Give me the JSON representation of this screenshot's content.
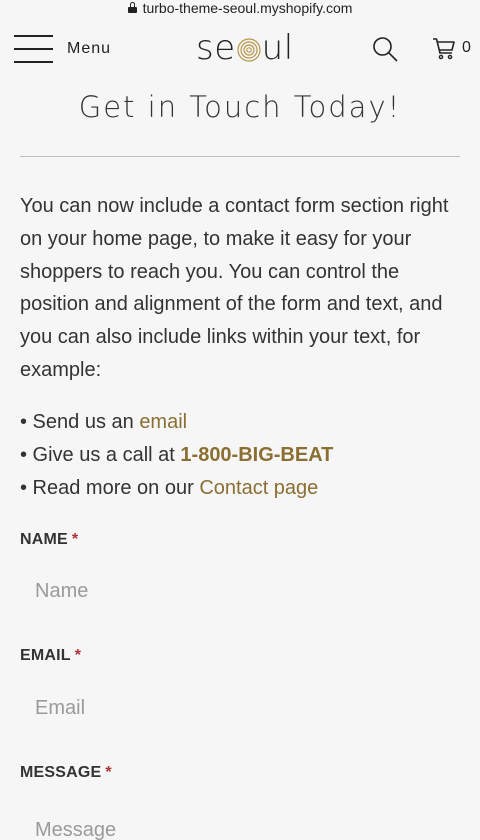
{
  "browser": {
    "url": "turbo-theme-seoul.myshopify.com"
  },
  "header": {
    "menu_label": "Menu",
    "logo_text_left": "se",
    "logo_text_right": "ul",
    "cart_count": "0"
  },
  "page": {
    "title": "Get in Touch Today!",
    "intro": "You can now include a contact form section right on your home page, to make it easy for your shoppers to reach you. You can control the position and alignment of the form and text, and you can also include links within your text, for example:",
    "links": [
      {
        "prefix": "• Send us an ",
        "link": "email"
      },
      {
        "prefix": "• Give us a call at ",
        "link": "1-800-BIG-BEAT"
      },
      {
        "prefix": "• Read more on our ",
        "link": "Contact page"
      }
    ]
  },
  "form": {
    "name_label": "NAME",
    "name_placeholder": "Name",
    "email_label": "EMAIL",
    "email_placeholder": "Email",
    "message_label": "MESSAGE",
    "message_placeholder": "Message",
    "required_mark": "*"
  },
  "colors": {
    "accent": "#8b6f32",
    "required": "#b0313a",
    "background": "#f6f6f6"
  }
}
